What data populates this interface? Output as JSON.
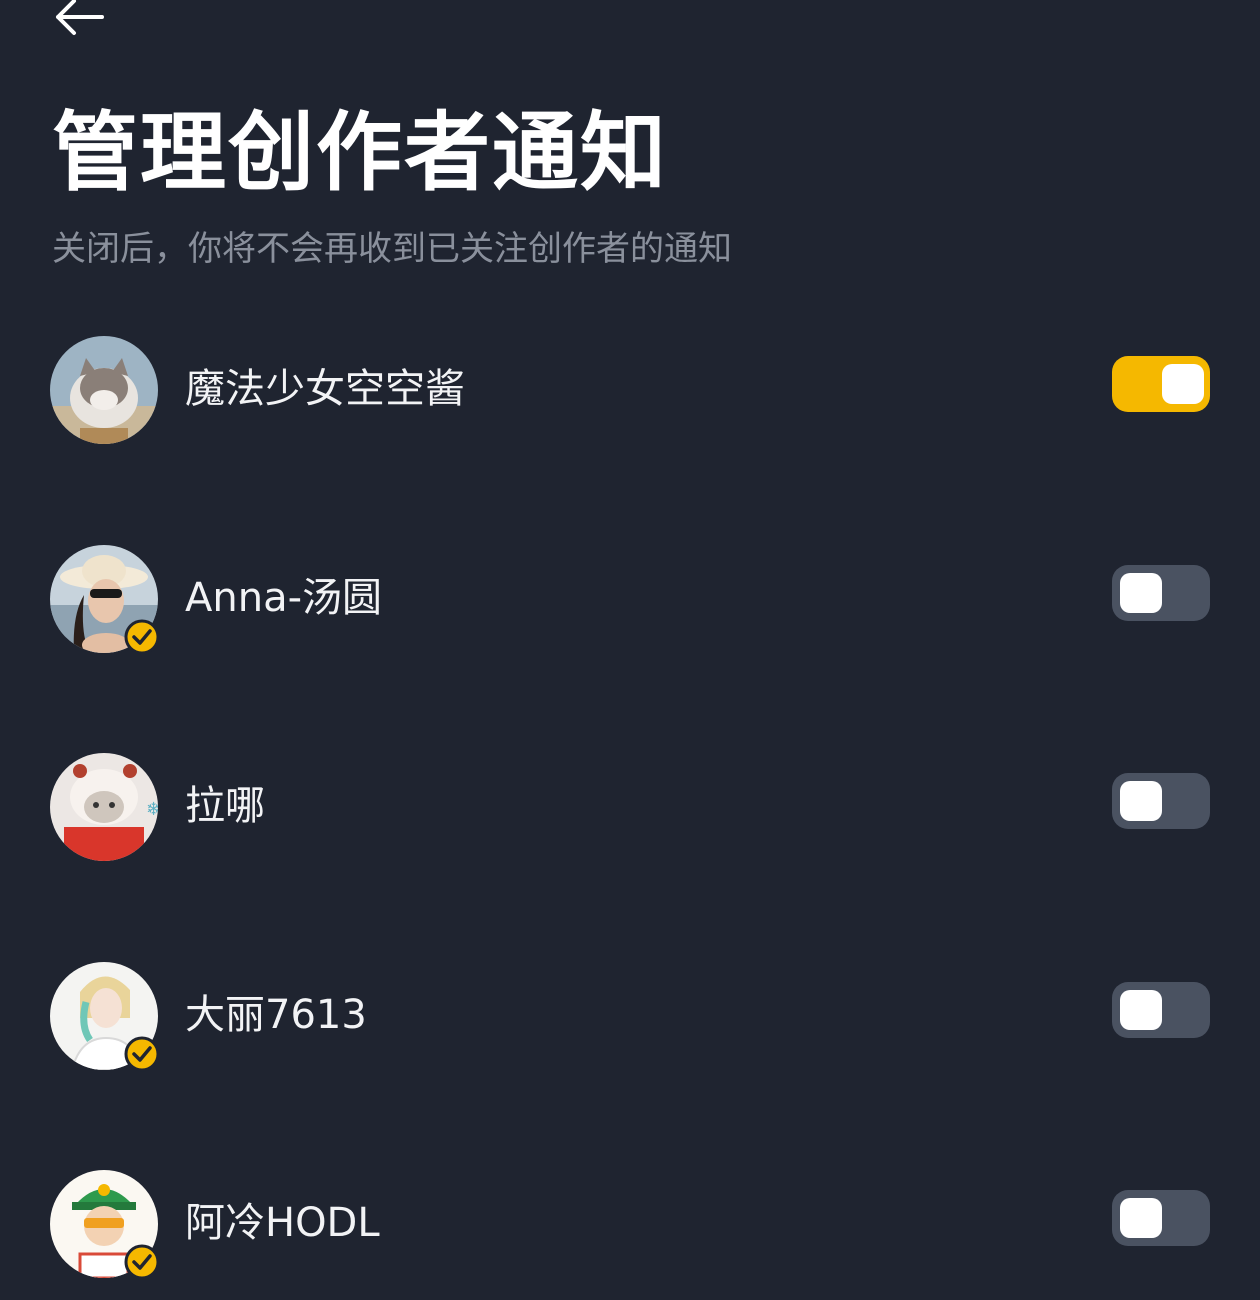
{
  "header": {
    "back_icon": "arrow-left-icon",
    "title": "管理创作者通知",
    "subtitle": "关闭后，你将不会再收到已关注创作者的通知"
  },
  "colors": {
    "background": "#1f2430",
    "toggle_on": "#f5b800",
    "toggle_off": "#4a5261",
    "verified_badge": "#f5b800",
    "subtitle_text": "#8a909c"
  },
  "creators": [
    {
      "name": "魔法少女空空酱",
      "verified": false,
      "notifications_on": true
    },
    {
      "name": "Anna-汤圆",
      "verified": true,
      "notifications_on": false
    },
    {
      "name": "拉哪",
      "verified": false,
      "notifications_on": false
    },
    {
      "name": "大丽7613",
      "verified": true,
      "notifications_on": false
    },
    {
      "name": "阿冷HODL",
      "verified": true,
      "notifications_on": false
    }
  ]
}
